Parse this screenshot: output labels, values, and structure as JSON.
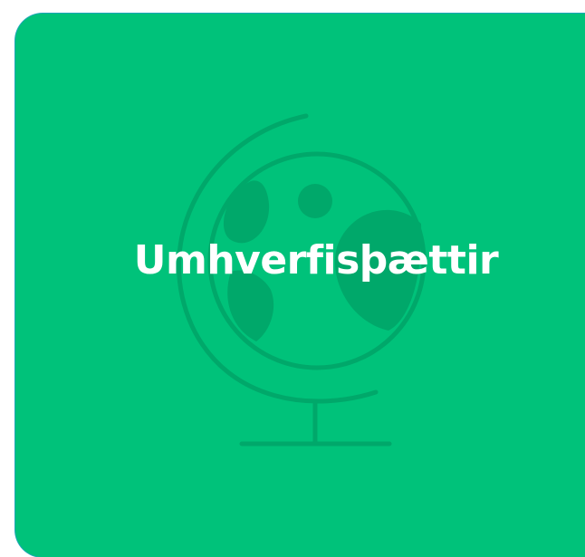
{
  "card": {
    "title": "Umhverfisþættir",
    "icon": "globe-icon",
    "colors": {
      "background": "#00c27a",
      "icon_tint": "#00a86a",
      "text": "#ffffff",
      "border": "#1fa6b8"
    }
  }
}
